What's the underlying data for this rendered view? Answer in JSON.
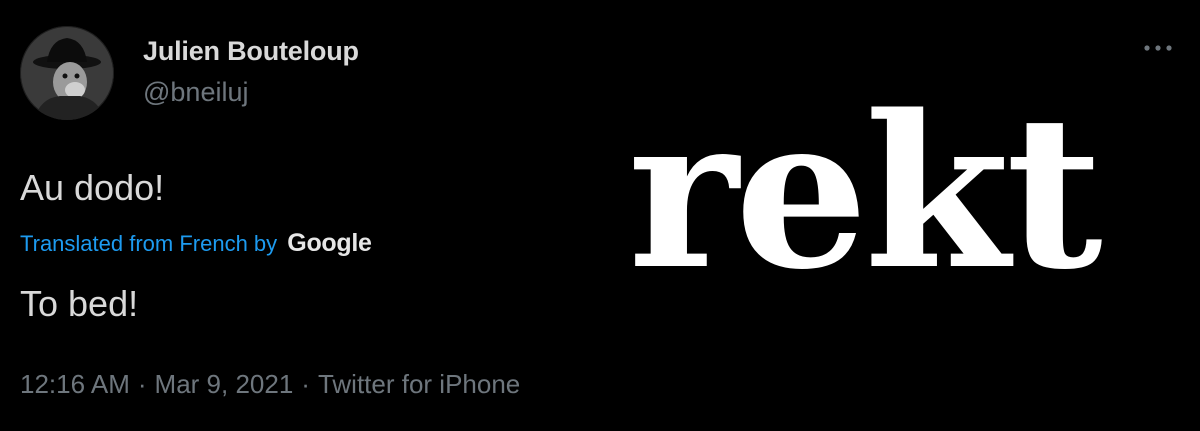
{
  "tweet": {
    "author": {
      "display_name": "Julien Bouteloup",
      "handle": "@bneiluj",
      "avatar_icon": "avatar-portrait"
    },
    "more_icon": "more-horizontal-icon",
    "original_text": "Au dodo!",
    "translation": {
      "label": "Translated from French by",
      "provider": "Google"
    },
    "translated_text": "To bed!",
    "meta": {
      "time": "12:16 AM",
      "separator": "·",
      "date": "Mar 9, 2021",
      "source": "Twitter for iPhone"
    }
  },
  "overlay": {
    "text": "rekt"
  },
  "colors": {
    "background": "#000000",
    "primary_text": "#d9d9d9",
    "secondary_text": "#6e767d",
    "link": "#1d9bf0",
    "overlay": "#ffffff"
  }
}
